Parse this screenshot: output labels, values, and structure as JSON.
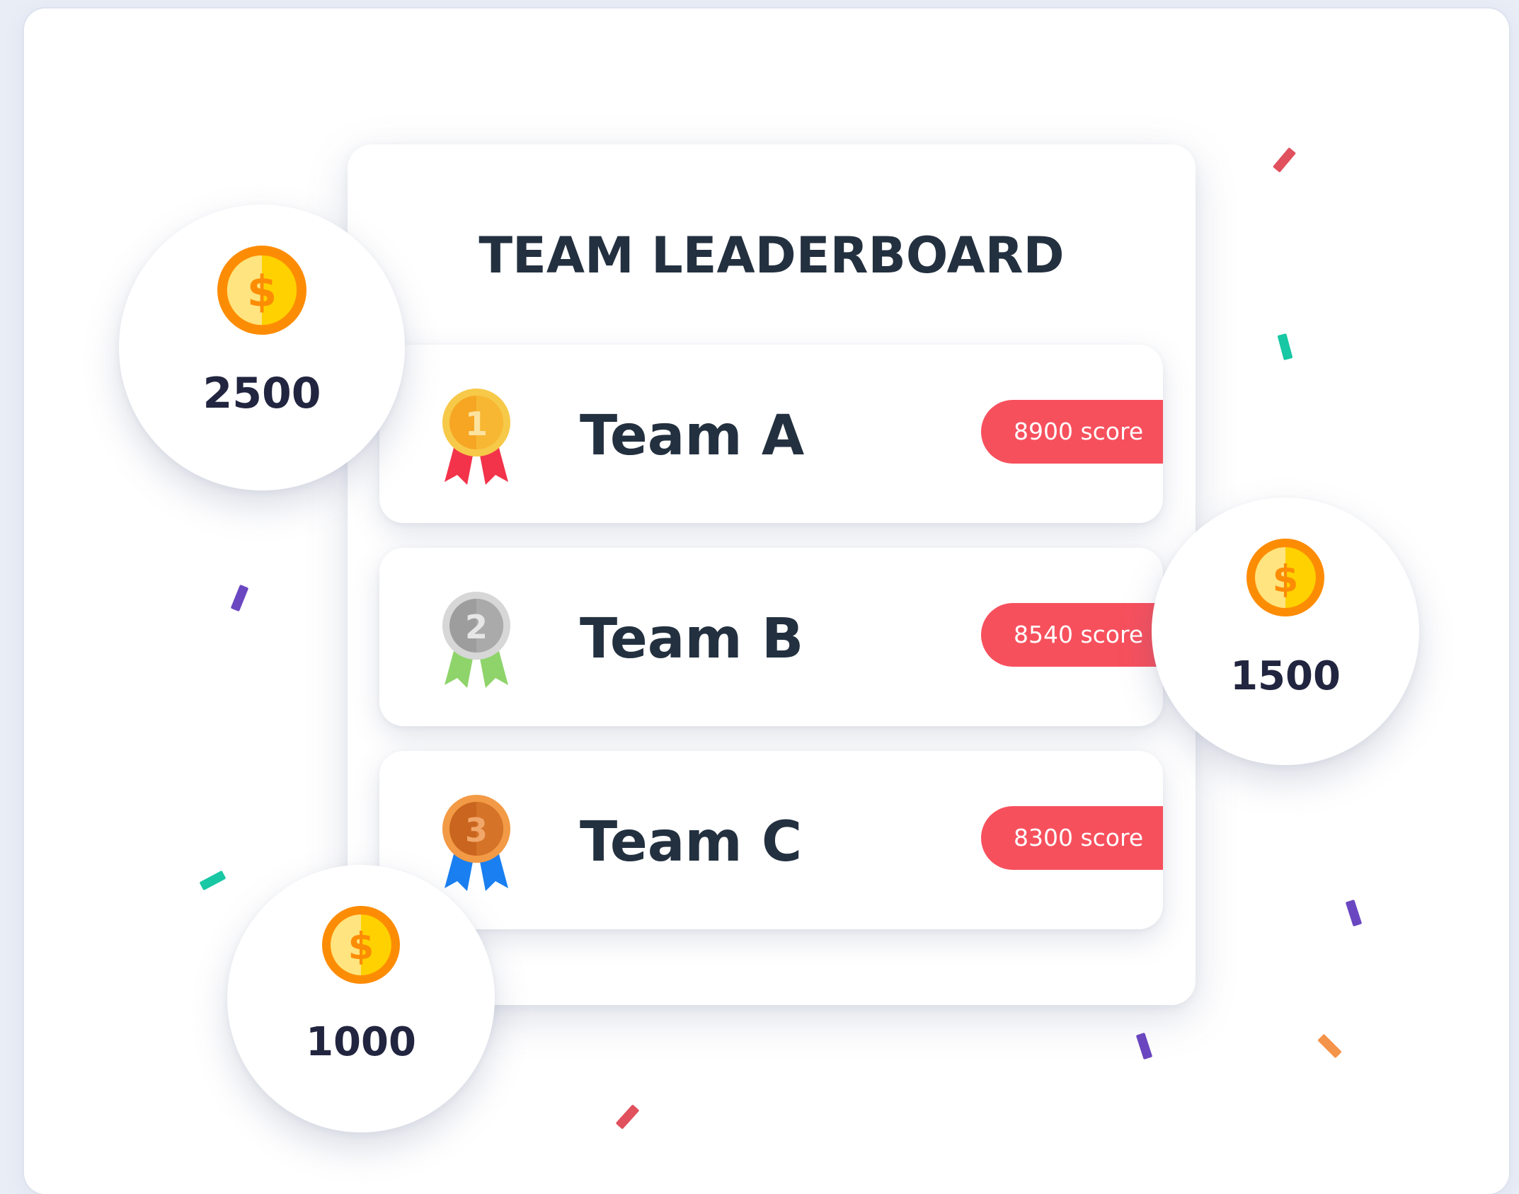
{
  "title": "TEAM LEADERBOARD",
  "teams": [
    {
      "rank": 1,
      "name": "Team A",
      "score_label": "8900 score",
      "medal_icon": "gold-medal-icon"
    },
    {
      "rank": 2,
      "name": "Team B",
      "score_label": "8540 score",
      "medal_icon": "silver-medal-icon"
    },
    {
      "rank": 3,
      "name": "Team C",
      "score_label": "8300 score",
      "medal_icon": "bronze-medal-icon"
    }
  ],
  "coin_bubbles": [
    {
      "amount": "2500",
      "icon": "dollar-coin-icon"
    },
    {
      "amount": "1500",
      "icon": "dollar-coin-icon"
    },
    {
      "amount": "1000",
      "icon": "dollar-coin-icon"
    }
  ],
  "medal_numbers": [
    "1",
    "2",
    "3"
  ],
  "coin_symbol": "$",
  "colors": {
    "accent": "#f7505d",
    "text_dark": "#23303f",
    "gold": "#f7b500",
    "silver": "#a6a6a6",
    "bronze": "#cf6f2a",
    "confetti": [
      "#e0505d",
      "#f4934a",
      "#18c7a4",
      "#6b46c1"
    ]
  }
}
